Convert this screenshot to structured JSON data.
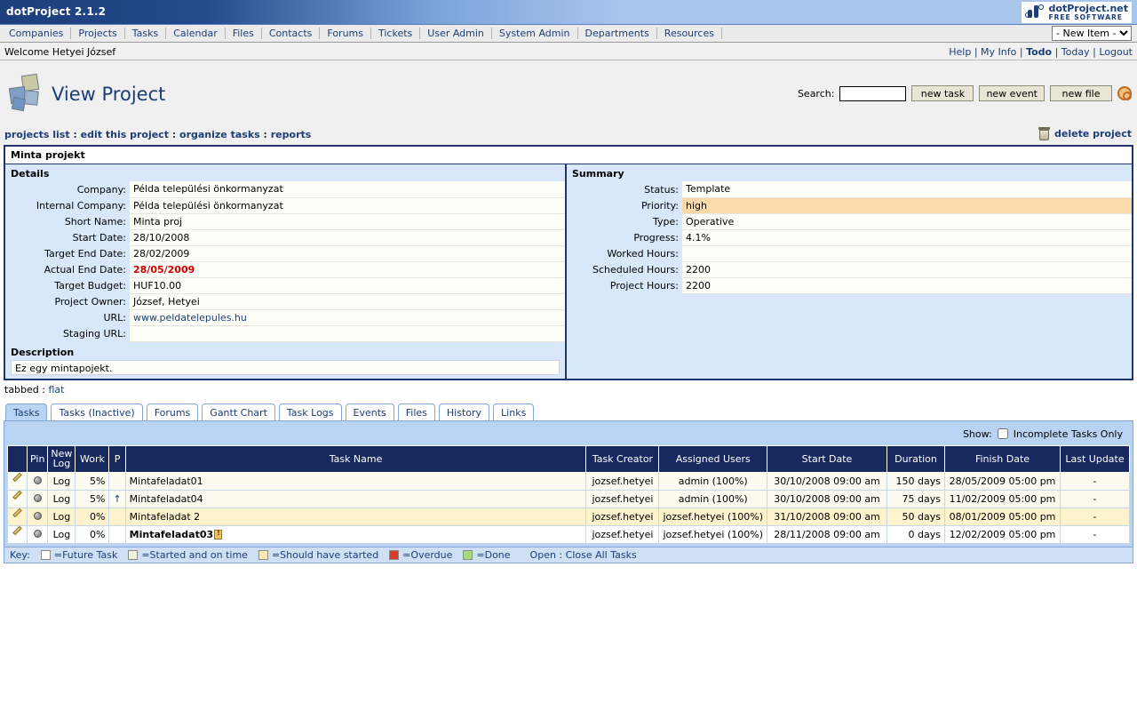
{
  "titlebar": {
    "app_title": "dotProject 2.1.2",
    "brand_name": "dotProject.net",
    "brand_sub": "FREE SOFTWARE"
  },
  "nav": {
    "items": [
      "Companies",
      "Projects",
      "Tasks",
      "Calendar",
      "Files",
      "Contacts",
      "Forums",
      "Tickets",
      "User Admin",
      "System Admin",
      "Departments",
      "Resources"
    ],
    "new_item_selected": "- New Item -",
    "new_item_options": [
      "- New Item -"
    ]
  },
  "welcome": {
    "text": "Welcome Hetyei József",
    "links": [
      "Help",
      "My Info",
      "Todo",
      "Today",
      "Logout"
    ],
    "bold_link": "Todo"
  },
  "header": {
    "page_title": "View Project",
    "search_label": "Search:",
    "search_value": "",
    "search_placeholder": "",
    "buttons": [
      "new task",
      "new event",
      "new file"
    ],
    "help_icon": "help-circle-icon"
  },
  "crumbs": {
    "items": [
      "projects list",
      "edit this project",
      "organize tasks",
      "reports"
    ],
    "separator": " : ",
    "delete_label": "delete project",
    "trash_icon": "trash-icon"
  },
  "project": {
    "name": "Minta projekt",
    "details_heading": "Details",
    "details": [
      {
        "label": "Company:",
        "value": "Példa települési önkormanyzat"
      },
      {
        "label": "Internal Company:",
        "value": "Példa települési önkormanyzat"
      },
      {
        "label": "Short Name:",
        "value": "Minta proj"
      },
      {
        "label": "Start Date:",
        "value": "28/10/2008"
      },
      {
        "label": "Target End Date:",
        "value": "28/02/2009"
      },
      {
        "label": "Actual End Date:",
        "value": "28/05/2009",
        "style": "red"
      },
      {
        "label": "Target Budget:",
        "value": "HUF10.00"
      },
      {
        "label": "Project Owner:",
        "value": "József, Hetyei"
      },
      {
        "label": "URL:",
        "value": "www.peldatelepules.hu",
        "style": "link"
      },
      {
        "label": "Staging URL:",
        "value": ""
      }
    ],
    "summary_heading": "Summary",
    "summary": [
      {
        "label": "Status:",
        "value": "Template"
      },
      {
        "label": "Priority:",
        "value": "high",
        "style": "highlight"
      },
      {
        "label": "Type:",
        "value": "Operative"
      },
      {
        "label": "Progress:",
        "value": "4.1%"
      },
      {
        "label": "Worked Hours:",
        "value": ""
      },
      {
        "label": "Scheduled Hours:",
        "value": "2200"
      },
      {
        "label": "Project Hours:",
        "value": "2200"
      }
    ],
    "description_heading": "Description",
    "description_text": "Ez egy mintapojekt."
  },
  "viewmode": {
    "tabbed": "tabbed",
    "separator": " : ",
    "flat": "flat"
  },
  "tabs": [
    {
      "label": "Tasks",
      "active": true
    },
    {
      "label": "Tasks (Inactive)",
      "active": false
    },
    {
      "label": "Forums",
      "active": false
    },
    {
      "label": "Gantt Chart",
      "active": false
    },
    {
      "label": "Task Logs",
      "active": false
    },
    {
      "label": "Events",
      "active": false
    },
    {
      "label": "Files",
      "active": false
    },
    {
      "label": "History",
      "active": false
    },
    {
      "label": "Links",
      "active": false
    }
  ],
  "show": {
    "label": "Show:",
    "checkbox_label": "Incomplete Tasks Only",
    "checked": false
  },
  "tasks_table": {
    "columns": [
      "",
      "Pin",
      "New Log",
      "Work",
      "P",
      "Task Name",
      "Task Creator",
      "Assigned Users",
      "Start Date",
      "Duration",
      "Finish Date",
      "Last Update"
    ],
    "rows": [
      {
        "edit_icon": "pencil-icon",
        "pin_icon": "pin-ball-icon",
        "new_log": "Log",
        "work": "5%",
        "priority": "",
        "name": "Mintafeladat01",
        "name_bold": false,
        "creator": "jozsef.hetyei",
        "assigned": "admin (100%)",
        "start": "30/10/2008 09:00 am",
        "duration": "150 days",
        "finish": "28/05/2009 05:00 pm",
        "last_update": "-",
        "state": "ontime"
      },
      {
        "edit_icon": "pencil-icon",
        "pin_icon": "pin-ball-icon",
        "new_log": "Log",
        "work": "5%",
        "priority": "↑",
        "name": "Mintafeladat04",
        "name_bold": false,
        "creator": "jozsef.hetyei",
        "assigned": "admin (100%)",
        "start": "30/10/2008 09:00 am",
        "duration": "75 days",
        "finish": "11/02/2009 05:00 pm",
        "last_update": "-",
        "state": "ontime"
      },
      {
        "edit_icon": "pencil-icon",
        "pin_icon": "pin-ball-icon",
        "new_log": "Log",
        "work": "0%",
        "priority": "",
        "name": "Mintafeladat 2",
        "name_bold": false,
        "creator": "jozsef.hetyei",
        "assigned": "jozsef.hetyei (100%)",
        "start": "31/10/2008 09:00 am",
        "duration": "50 days",
        "finish": "08/01/2009 05:00 pm",
        "last_update": "-",
        "state": "should"
      },
      {
        "edit_icon": "pencil-icon",
        "pin_icon": "pin-ball-icon",
        "new_log": "Log",
        "work": "0%",
        "priority": "",
        "name": "Mintafeladat03",
        "name_bold": true,
        "name_badge": "note-icon",
        "creator": "jozsef.hetyei",
        "assigned": "jozsef.hetyei (100%)",
        "start": "28/11/2008 09:00 am",
        "duration": "0 days",
        "finish": "12/02/2009 05:00 pm",
        "last_update": "-",
        "state": "future"
      }
    ]
  },
  "key": {
    "label": "Key:",
    "entries": [
      {
        "color": "#ffffff",
        "text": "=Future Task"
      },
      {
        "color": "#edf3e0",
        "text": "=Started and on time"
      },
      {
        "color": "#fde9b0",
        "text": "=Should have started"
      },
      {
        "color": "#dd3b2a",
        "text": "=Overdue"
      },
      {
        "color": "#a8d878",
        "text": "=Done"
      }
    ],
    "open_label": "Open",
    "separator": " : ",
    "close_label": "Close All Tasks"
  },
  "colors": {
    "titlebar_dark": "#1c3f7c",
    "titlebar_light": "#a8c6ec",
    "panel_border": "#20356e",
    "panel_bg": "#d8e8fa",
    "tab_active": "#b8d4f2",
    "table_header": "#17295e",
    "link": "#1b3d78",
    "alert_red": "#cc0000",
    "priority_highlight": "#fcd9a8"
  }
}
